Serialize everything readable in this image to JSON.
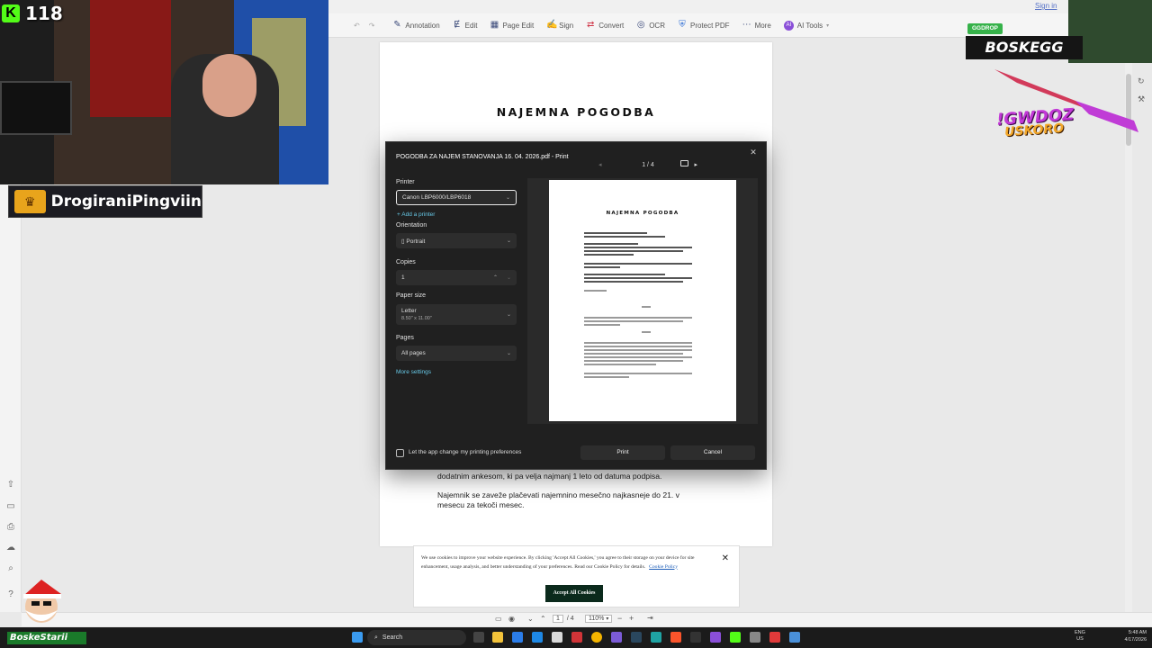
{
  "app": {
    "sign_in": "Sign in",
    "toolbar": [
      {
        "icon": "pen-icon",
        "label": "Annotation"
      },
      {
        "icon": "edit-icon",
        "label": "Edit"
      },
      {
        "icon": "page-edit-icon",
        "label": "Page Edit"
      },
      {
        "icon": "sign-icon",
        "label": "Sign"
      },
      {
        "icon": "convert-icon",
        "label": "Convert"
      },
      {
        "icon": "ocr-icon",
        "label": "OCR"
      },
      {
        "icon": "shield-icon",
        "label": "Protect PDF"
      },
      {
        "icon": "more-icon",
        "label": "More"
      },
      {
        "icon": "ai-icon",
        "label": "AI Tools"
      }
    ]
  },
  "document": {
    "title": "NAJEMNA POGODBA",
    "lines_below": [
      "dodatnim ankesom, ki pa velja najmanj 1 leto od datuma podpisa.",
      "Najemnik se zaveže plačevati najemnino mesečno najkasneje do 21. v",
      "mesecu za tekoči mesec."
    ]
  },
  "print_dialog": {
    "title": "POGODBA ZA NAJEM STANOVANJA 16. 04. 2026.pdf - Print",
    "close": "✕",
    "printer_label": "Printer",
    "printer_value": "Canon LBP6000/LBP6018",
    "add_printer": "Add a printer",
    "orientation_label": "Orientation",
    "orientation_value": "Portrait",
    "copies_label": "Copies",
    "copies_value": "1",
    "paper_size_label": "Paper size",
    "paper_size_value": "Letter",
    "paper_size_sub": "8.50\" x 11.00\"",
    "pages_label": "Pages",
    "pages_value": "All pages",
    "more_settings": "More settings",
    "preview_page_indicator": "1 / 4",
    "preview_title": "NAJEMNA POGODBA",
    "app_change_prefs": "Let the app change my printing preferences",
    "print_button": "Print",
    "cancel_button": "Cancel"
  },
  "cookie_banner": {
    "text": "We use cookies to improve your website experience. By clicking 'Accept All Cookies,' you agree to their storage on your device for site enhancement, usage analysis, and better understanding of your preferences. Read our Cookie Policy for details.",
    "link": "Cookie Policy",
    "accept": "Accept All Cookies",
    "close": "✕"
  },
  "bottom_bar": {
    "page_current": "1",
    "page_total": "/ 4",
    "zoom": "110%"
  },
  "taskbar": {
    "search_placeholder": "Search",
    "lang_top": "ENG",
    "lang_bottom": "US",
    "time": "5:48 AM",
    "date": "4/17/2026"
  },
  "overlay": {
    "viewer_badge": "K",
    "viewer_count": "118",
    "streamer_name": "DrogiraniPingviin",
    "ggdrop_badge": "GGDROP",
    "ggdrop_name": "BOSKEGG",
    "promo_top": "!GWDOZ",
    "promo_bottom": "USKORO",
    "santa_name": "BoskeStarii"
  },
  "colors": {
    "accent": "#67c8e6",
    "dialog_bg": "#202020",
    "kick_green": "#53fc18",
    "cookie_button": "#0b2a1c"
  }
}
